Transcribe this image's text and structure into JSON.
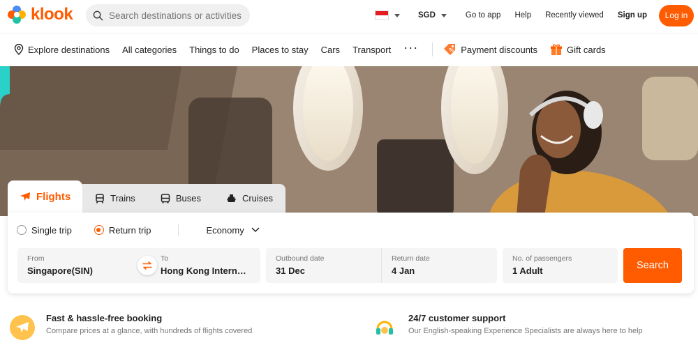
{
  "brand": {
    "name": "klook",
    "color": "#ff5b00"
  },
  "search": {
    "placeholder": "Search destinations or activities",
    "icon": "search-icon"
  },
  "topbar": {
    "currency": "SGD",
    "go_to_app": "Go to app",
    "help": "Help",
    "recently_viewed": "Recently viewed",
    "sign_up": "Sign up",
    "log_in": "Log in"
  },
  "nav": {
    "explore": "Explore destinations",
    "items": [
      "All categories",
      "Things to do",
      "Places to stay",
      "Cars",
      "Transport"
    ],
    "payment_discounts": "Payment discounts",
    "gift_cards": "Gift cards"
  },
  "tabs": [
    {
      "label": "Flights",
      "icon": "plane-icon",
      "active": true
    },
    {
      "label": "Trains",
      "icon": "train-icon",
      "active": false
    },
    {
      "label": "Buses",
      "icon": "bus-icon",
      "active": false
    },
    {
      "label": "Cruises",
      "icon": "cruise-icon",
      "active": false
    }
  ],
  "booking": {
    "trip_types": [
      {
        "label": "Single trip",
        "selected": false
      },
      {
        "label": "Return trip",
        "selected": true
      }
    ],
    "cabin_class": "Economy",
    "from": {
      "label": "From",
      "value": "Singapore(SIN)"
    },
    "to": {
      "label": "To",
      "value": "Hong Kong International Airport(HKG)"
    },
    "outbound": {
      "label": "Outbound date",
      "value": "31 Dec"
    },
    "return": {
      "label": "Return date",
      "value": "4 Jan"
    },
    "passengers": {
      "label": "No. of passengers",
      "value": "1 Adult"
    },
    "search_button": "Search"
  },
  "features": [
    {
      "title": "Fast & hassle-free booking",
      "desc": "Compare prices at a glance, with hundreds of flights covered",
      "icon": "plane-badge-icon"
    },
    {
      "title": "24/7 customer support",
      "desc": "Our English-speaking Experience Specialists are always here to help",
      "icon": "headset-icon"
    }
  ],
  "colors": {
    "accent": "#ff5b00",
    "field_bg": "#f5f5f5",
    "tab_inactive": "#e8e8e8"
  }
}
